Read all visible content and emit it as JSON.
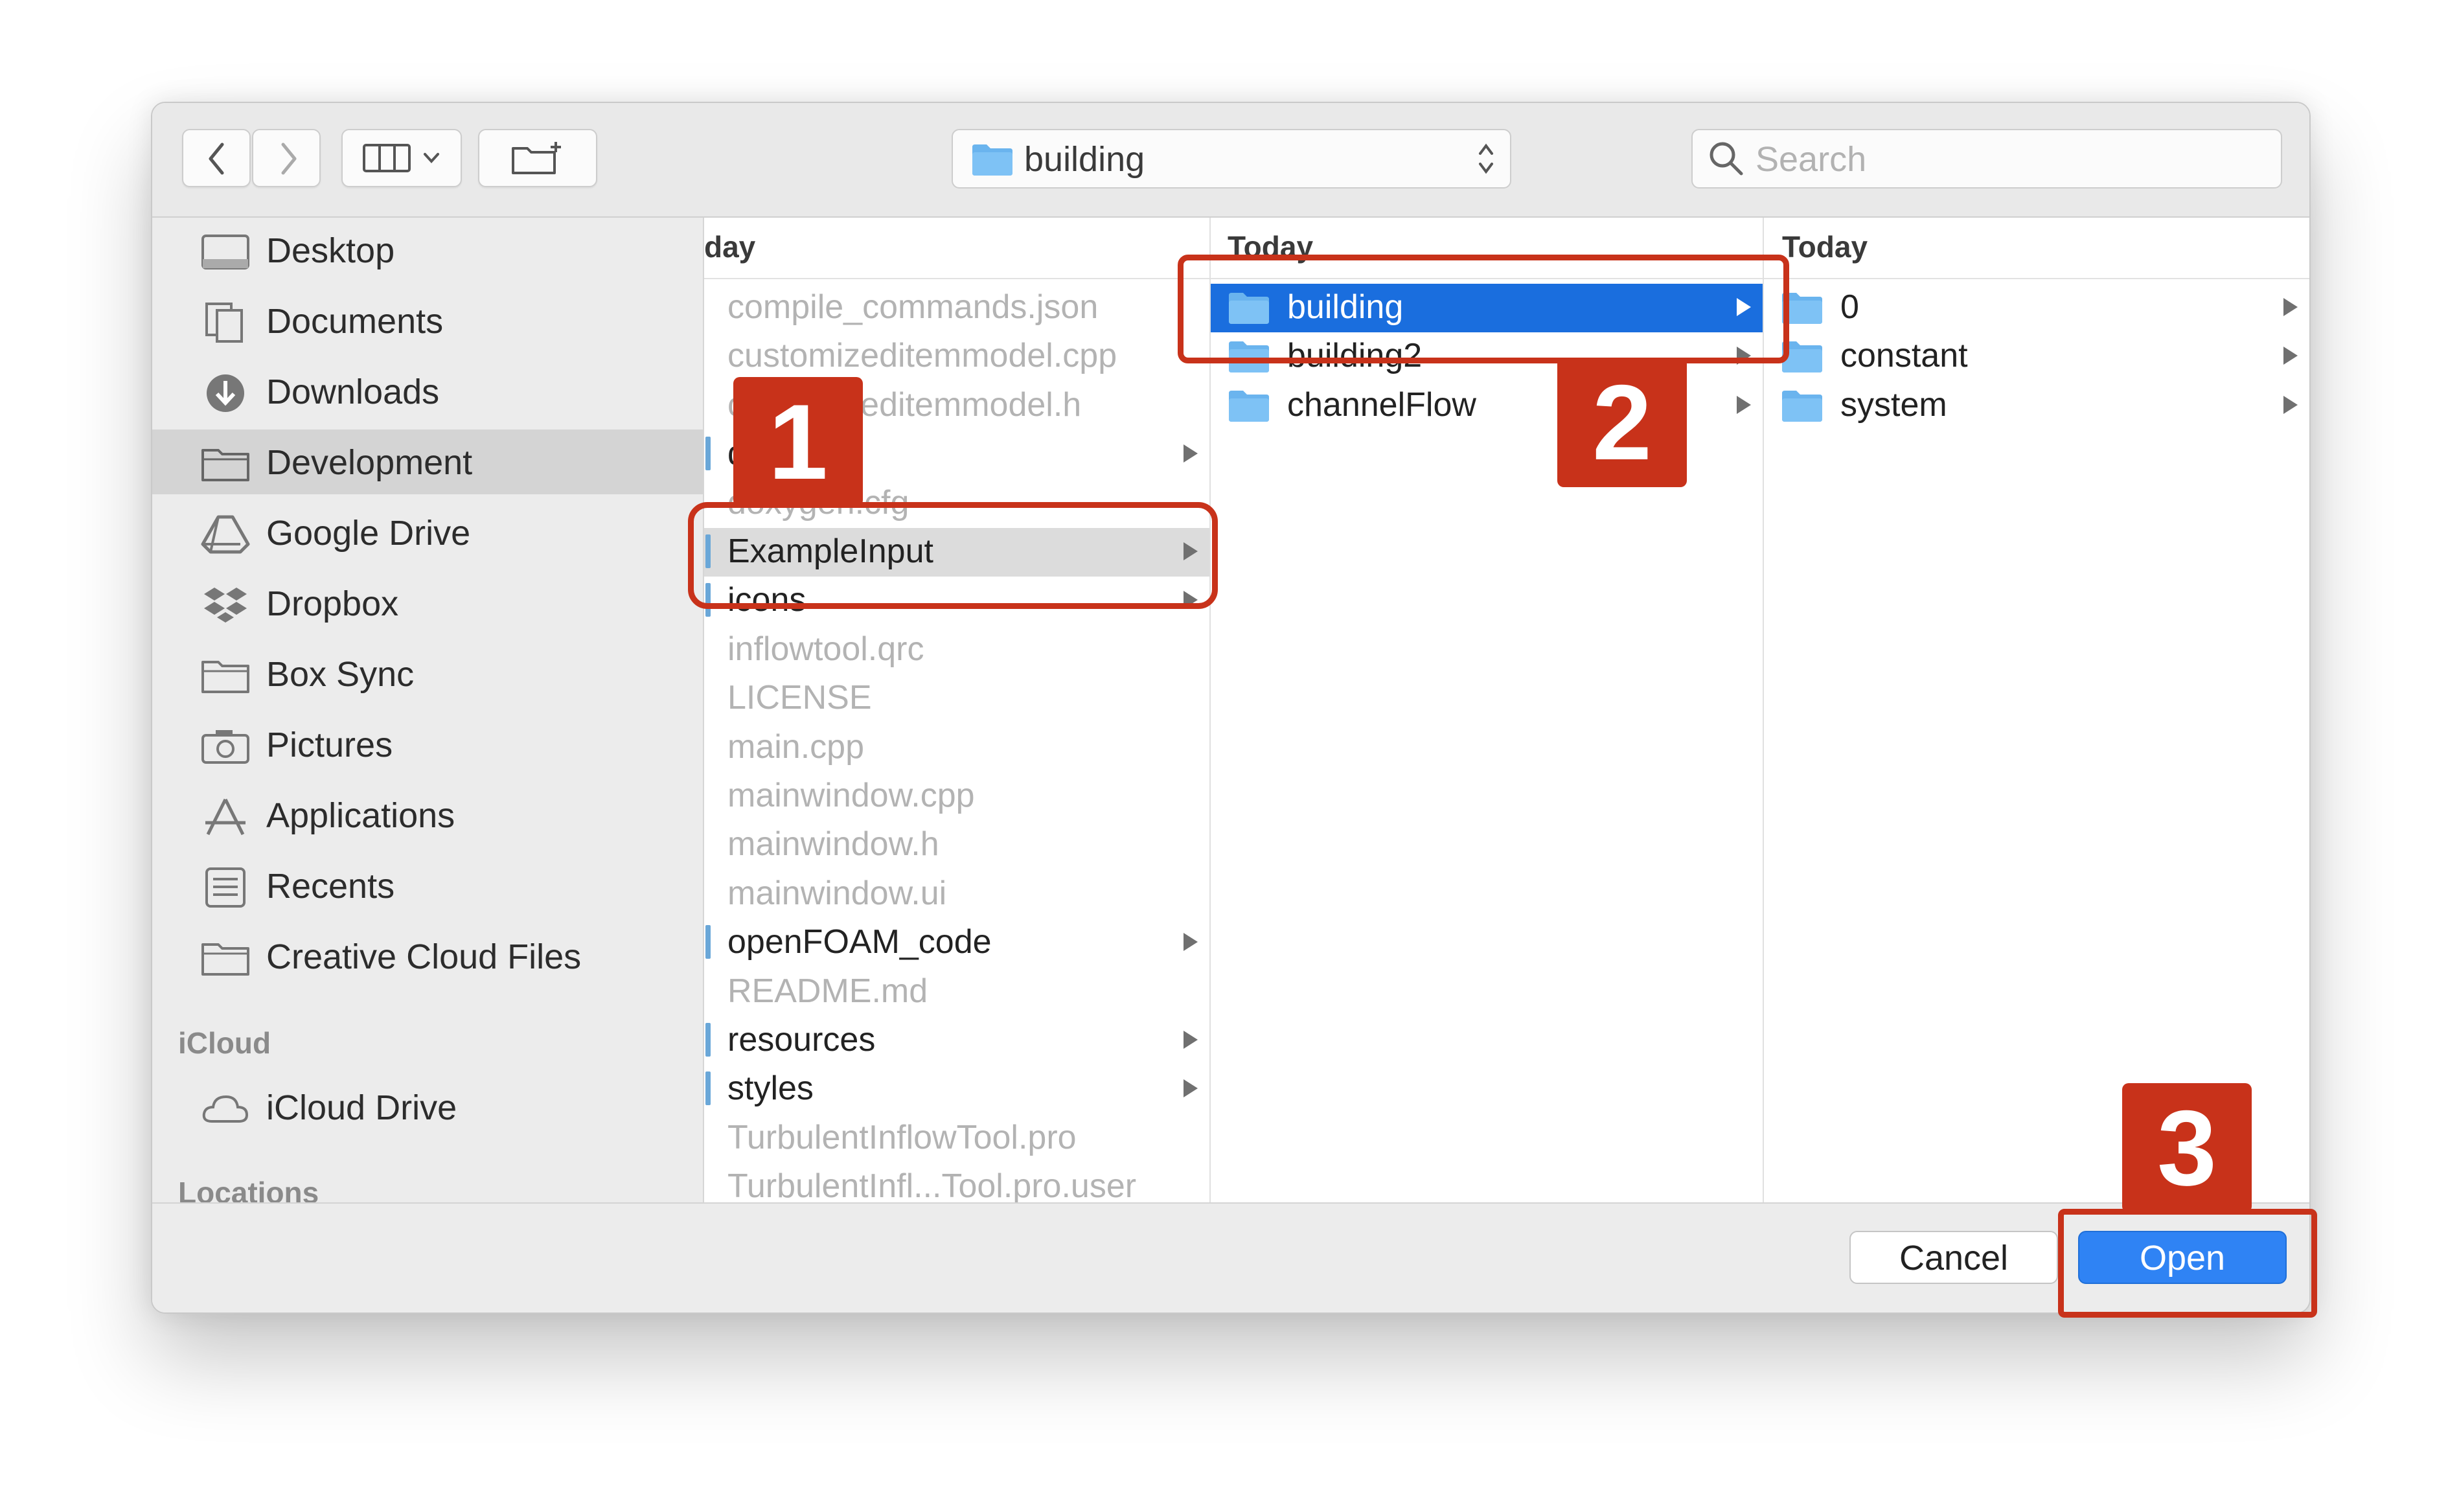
{
  "toolbar": {
    "back_label": "back",
    "forward_label": "forward",
    "view_mode": "columns",
    "new_folder": "new folder",
    "path": "building",
    "search_placeholder": "Search"
  },
  "sidebar": {
    "favorites": [
      {
        "label": "Desktop",
        "icon": "desktop-icon"
      },
      {
        "label": "Documents",
        "icon": "documents-icon"
      },
      {
        "label": "Downloads",
        "icon": "downloads-icon"
      },
      {
        "label": "Development",
        "icon": "folder-icon",
        "selected": true
      },
      {
        "label": "Google Drive",
        "icon": "google-drive-icon"
      },
      {
        "label": "Dropbox",
        "icon": "dropbox-icon"
      },
      {
        "label": "Box Sync",
        "icon": "folder-icon"
      },
      {
        "label": "Pictures",
        "icon": "camera-icon"
      },
      {
        "label": "Applications",
        "icon": "applications-icon"
      },
      {
        "label": "Recents",
        "icon": "recents-icon"
      },
      {
        "label": "Creative Cloud Files",
        "icon": "folder-icon"
      }
    ],
    "icloud_header": "iCloud",
    "icloud_items": [
      {
        "label": "iCloud Drive",
        "icon": "cloud-icon"
      }
    ],
    "locations_header": "Locations"
  },
  "columns": [
    {
      "header": "day",
      "items": [
        {
          "name": "compile_commands.json",
          "type": "file"
        },
        {
          "name": "customizeditemmodel.cpp",
          "type": "file"
        },
        {
          "name": "customizeditemmodel.h",
          "type": "file"
        },
        {
          "name": "d",
          "type": "dir"
        },
        {
          "name": "doxygen.cfg",
          "type": "file"
        },
        {
          "name": "ExampleInput",
          "type": "dir",
          "highlighted": true
        },
        {
          "name": "icons",
          "type": "dir"
        },
        {
          "name": "inflowtool.qrc",
          "type": "file"
        },
        {
          "name": "LICENSE",
          "type": "file"
        },
        {
          "name": "main.cpp",
          "type": "file"
        },
        {
          "name": "mainwindow.cpp",
          "type": "file"
        },
        {
          "name": "mainwindow.h",
          "type": "file"
        },
        {
          "name": "mainwindow.ui",
          "type": "file"
        },
        {
          "name": "openFOAM_code",
          "type": "dir"
        },
        {
          "name": "README.md",
          "type": "file"
        },
        {
          "name": "resources",
          "type": "dir"
        },
        {
          "name": "styles",
          "type": "dir"
        },
        {
          "name": "TurbulentInflowTool.pro",
          "type": "file"
        },
        {
          "name": "TurbulentInfl...Tool.pro.user",
          "type": "file"
        }
      ]
    },
    {
      "header": "Today",
      "items": [
        {
          "name": "building",
          "type": "dir",
          "selected": true
        },
        {
          "name": "building2",
          "type": "dir"
        },
        {
          "name": "channelFlow",
          "type": "dir"
        }
      ]
    },
    {
      "header": "Today",
      "items": [
        {
          "name": "0",
          "type": "dir"
        },
        {
          "name": "constant",
          "type": "dir"
        },
        {
          "name": "system",
          "type": "dir"
        }
      ]
    }
  ],
  "buttons": {
    "cancel": "Cancel",
    "open": "Open"
  },
  "callouts": [
    {
      "number": "1"
    },
    {
      "number": "2"
    },
    {
      "number": "3"
    }
  ],
  "colors": {
    "accent": "#1a6ede",
    "callout": "#c8321a",
    "folder": "#6aa7d8"
  }
}
